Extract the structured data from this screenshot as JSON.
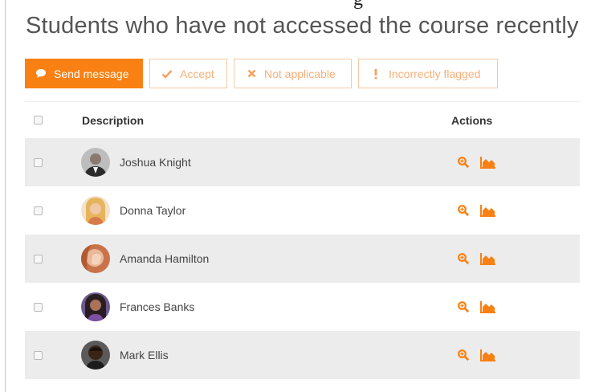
{
  "page": {
    "title": "Students who have not accessed the course recently",
    "top_fragment": "g"
  },
  "colors": {
    "accent": "#f98012",
    "accent_light_border": "#f7c9a4",
    "accent_light_text": "#f7b07a",
    "row_stripe": "#ececec"
  },
  "toolbar": {
    "send_message": {
      "label": "Send message",
      "icon": "speech-bubble-icon"
    },
    "accept": {
      "label": "Accept",
      "icon": "checkmark-icon"
    },
    "not_applicable": {
      "label": "Not applicable",
      "icon": "x-icon"
    },
    "incorrectly_flagged": {
      "label": "Incorrectly flagged",
      "icon": "exclamation-icon"
    }
  },
  "table": {
    "headers": {
      "select": "",
      "description": "Description",
      "actions": "Actions"
    },
    "rows": [
      {
        "name": "Joshua Knight",
        "avatar": "avatar-suit-man"
      },
      {
        "name": "Donna Taylor",
        "avatar": "avatar-blonde-woman"
      },
      {
        "name": "Amanda Hamilton",
        "avatar": "avatar-woman-hand"
      },
      {
        "name": "Frances Banks",
        "avatar": "avatar-dark-hair-woman"
      },
      {
        "name": "Mark Ellis",
        "avatar": "avatar-dark-man"
      }
    ],
    "row_actions": [
      "view-insight-icon",
      "insight-chart-icon"
    ]
  }
}
